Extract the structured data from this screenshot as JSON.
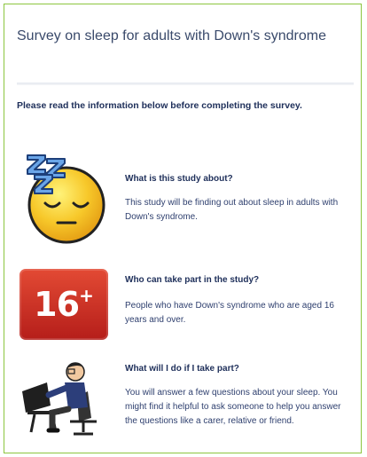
{
  "survey": {
    "title": "Survey on sleep for adults with Down's syndrome",
    "intro": "Please read the information below before completing the survey."
  },
  "sections": [
    {
      "heading": "What is this study about?",
      "body": "This study will be finding out about sleep in adults with Down's syndrome.",
      "icon": "sleeping-face-icon"
    },
    {
      "heading": "Who can take part in the study?",
      "body": "People who have Down's syndrome who are aged 16 years and over.",
      "icon": "age-16-plus-icon",
      "badge_number": "16",
      "badge_plus": "+"
    },
    {
      "heading": "What will I do if I take part?",
      "body": "You will answer a few questions about your sleep. You might find it helpful to ask someone to help you answer the questions like a carer, relative or friend.",
      "icon": "person-at-computer-icon"
    }
  ],
  "colors": {
    "border": "#8cc63f",
    "title": "#3a4a6b",
    "heading": "#1e2f5a",
    "badge": "#d03a2a"
  }
}
